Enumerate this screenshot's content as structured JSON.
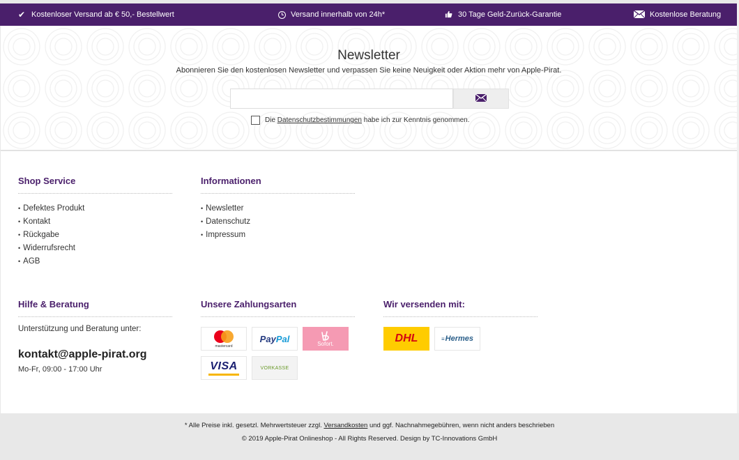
{
  "topbar": {
    "items": [
      {
        "icon": "check-icon",
        "label": "Kostenloser Versand ab € 50,- Bestellwert"
      },
      {
        "icon": "clock-icon",
        "label": "Versand innerhalb von 24h*"
      },
      {
        "icon": "thumbs-up-icon",
        "label": "30 Tage Geld-Zurück-Garantie"
      },
      {
        "icon": "envelope-icon",
        "label": "Kostenlose Beratung"
      }
    ],
    "bg_color": "#4a1f6b"
  },
  "newsletter": {
    "title": "Newsletter",
    "subtitle": "Abonnieren Sie den kostenlosen Newsletter und verpassen Sie keine Neuigkeit oder Aktion mehr von Apple-Pirat.",
    "email_value": "",
    "consent_prefix": "Die",
    "consent_link": "Datenschutzbestimmungen",
    "consent_suffix": "habe ich zur Kenntnis genommen.",
    "consent_checked": false
  },
  "footer": {
    "shop_service": {
      "title": "Shop Service",
      "items": [
        "Defektes Produkt",
        "Kontakt",
        "Rückgabe",
        "Widerrufsrecht",
        "AGB"
      ]
    },
    "informationen": {
      "title": "Informationen",
      "items": [
        "Newsletter",
        "Datenschutz",
        "Impressum"
      ]
    },
    "hilfe": {
      "title": "Hilfe & Beratung",
      "text": "Unterstützung und Beratung unter:",
      "email": "kontakt@apple-pirat.org",
      "hours": "Mo-Fr, 09:00 - 17:00 Uhr"
    },
    "zahlungsarten": {
      "title": "Unsere Zahlungsarten",
      "mastercard_label": "mastercard",
      "paypal_p1": "Pay",
      "paypal_p2": "Pal",
      "sofort_label": "Sofort.",
      "visa_label": "VISA",
      "vorkasse_label": "VORKASSE"
    },
    "versand": {
      "title": "Wir versenden mit:",
      "dhl_label": "DHL",
      "hermes_label": "Hermes"
    },
    "accent_color": "#4a1f6b"
  },
  "bottom": {
    "line1_prefix": "* Alle Preise inkl. gesetzl. Mehrwertsteuer zzgl.",
    "line1_link": "Versandkosten",
    "line1_suffix": "und ggf. Nachnahmegebühren, wenn nicht anders beschrieben",
    "line2": "© 2019 Apple-Pirat Onlineshop - All Rights Reserved. Design by TC-Innovations GmbH"
  }
}
